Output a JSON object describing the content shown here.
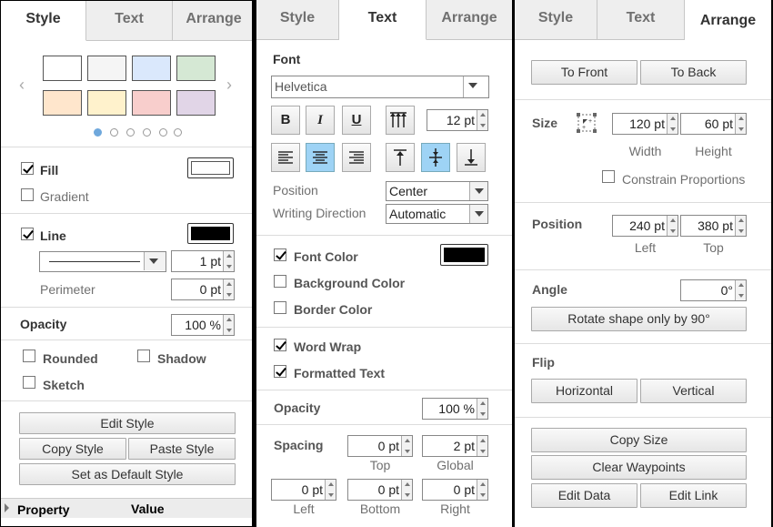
{
  "tabs": [
    "Style",
    "Text",
    "Arrange"
  ],
  "style_panel": {
    "fill_label": "Fill",
    "gradient_label": "Gradient",
    "line_label": "Line",
    "line_width": "1 pt",
    "perimeter_label": "Perimeter",
    "perimeter_value": "0 pt",
    "opacity_label": "Opacity",
    "opacity_value": "100 %",
    "rounded_label": "Rounded",
    "shadow_label": "Shadow",
    "sketch_label": "Sketch",
    "edit_style": "Edit Style",
    "copy_style": "Copy Style",
    "paste_style": "Paste Style",
    "set_default": "Set as Default Style",
    "property_header": "Property",
    "value_header": "Value",
    "swatches": [
      "#ffffff",
      "#f5f5f5",
      "#dae8fc",
      "#d5e8d4",
      "#ffe6cc",
      "#fff2cc",
      "#f8cecc",
      "#e1d5e7"
    ],
    "fill_color": "#ffffff",
    "line_color": "#000000"
  },
  "text_panel": {
    "font_label": "Font",
    "font_name": "Helvetica",
    "font_size": "12 pt",
    "bold": "B",
    "italic": "I",
    "underline": "U",
    "position_label": "Position",
    "position_value": "Center",
    "writing_direction_label": "Writing Direction",
    "writing_direction_value": "Automatic",
    "font_color_label": "Font Color",
    "background_color_label": "Background Color",
    "border_color_label": "Border Color",
    "word_wrap_label": "Word Wrap",
    "formatted_text_label": "Formatted Text",
    "opacity_label": "Opacity",
    "opacity_value": "100 %",
    "spacing_label": "Spacing",
    "spacing_top": "0 pt",
    "spacing_global": "2 pt",
    "spacing_left": "0 pt",
    "spacing_bottom": "0 pt",
    "spacing_right": "0 pt",
    "top_label": "Top",
    "global_label": "Global",
    "left_label": "Left",
    "bottom_label": "Bottom",
    "right_label": "Right",
    "font_color": "#000000"
  },
  "arrange_panel": {
    "to_front": "To Front",
    "to_back": "To Back",
    "size_label": "Size",
    "width_value": "120 pt",
    "height_value": "60 pt",
    "width_label": "Width",
    "height_label": "Height",
    "constrain_label": "Constrain Proportions",
    "position_label": "Position",
    "left_value": "240 pt",
    "top_value": "380 pt",
    "left_label": "Left",
    "top_label": "Top",
    "angle_label": "Angle",
    "angle_value": "0°",
    "rotate_button": "Rotate shape only by 90°",
    "flip_label": "Flip",
    "horizontal": "Horizontal",
    "vertical": "Vertical",
    "copy_size": "Copy Size",
    "clear_waypoints": "Clear Waypoints",
    "edit_data": "Edit Data",
    "edit_link": "Edit Link"
  }
}
